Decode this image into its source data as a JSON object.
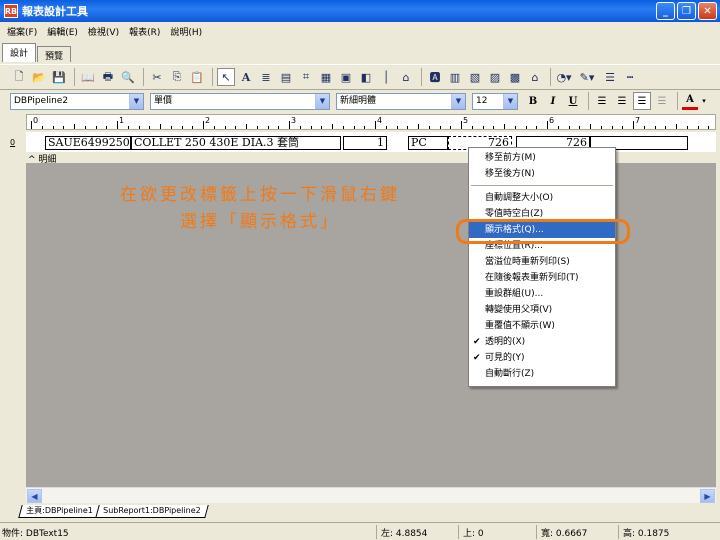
{
  "window": {
    "title": "報表設計工具",
    "icon_label": "RB"
  },
  "menu": [
    "檔案(F)",
    "編輯(E)",
    "檢視(V)",
    "報表(R)",
    "說明(H)"
  ],
  "tabs": [
    {
      "label": "設計"
    },
    {
      "label": "預覽"
    }
  ],
  "toolbar2": {
    "pipeline": "DBPipeline2",
    "field": "單價",
    "band": "新細明體",
    "font_size": "12"
  },
  "ruler": [
    "0",
    "1",
    "2",
    "3",
    "4",
    "5",
    "6",
    "7"
  ],
  "band_marker": "0",
  "detail_fields": [
    "SAUE6499250",
    "COLLET 250 430E DIA.3 套筒",
    "1",
    "PC",
    "726",
    "726"
  ],
  "band_label": "^ 明細",
  "annotation": {
    "line1": "在欲更改標籤上按一下滑鼠右鍵",
    "line2": "選擇「顯示格式」",
    "color": "#f07a18"
  },
  "context_menu": {
    "items": [
      {
        "label": "移至前方(M)",
        "checked": false
      },
      {
        "label": "移至後方(N)",
        "checked": false
      },
      {
        "label": "自動調整大小(O)",
        "checked": false
      },
      {
        "label": "零值時空白(Z)",
        "checked": false
      },
      {
        "label": "顯示格式(Q)...",
        "checked": false,
        "highlighted": true
      },
      {
        "label": "座標位置(R)...",
        "checked": false
      },
      {
        "label": "當溢位時重新列印(S)",
        "checked": false
      },
      {
        "label": "在隨後報表重新列印(T)",
        "checked": false
      },
      {
        "label": "重設群組(U)...",
        "checked": false
      },
      {
        "label": "轉變使用父項(V)",
        "checked": false
      },
      {
        "label": "重覆值不顯示(W)",
        "checked": false
      },
      {
        "label": "透明的(X)",
        "checked": true
      },
      {
        "label": "可見的(Y)",
        "checked": true
      },
      {
        "label": "自動斷行(Z)",
        "checked": false
      }
    ],
    "highlight_color": "#316ac5"
  },
  "bottom_tabs": [
    "主頁:DBPipeline1",
    "SubReport1:DBPipeline2"
  ],
  "status": {
    "object": "物件: DBText15",
    "left": "左: 4.8854",
    "top": "上: 0",
    "width": "寬: 0.6667",
    "height": "高: 0.1875"
  }
}
